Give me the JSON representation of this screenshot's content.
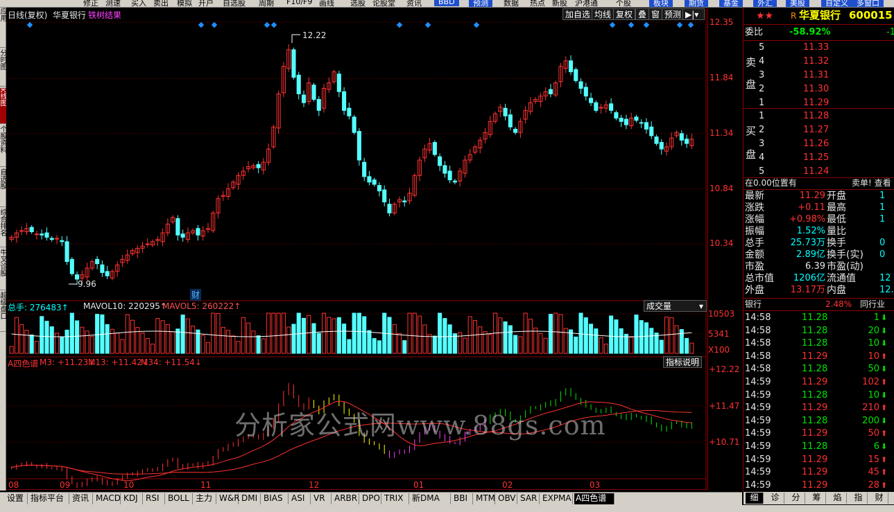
{
  "toolbar": [
    "修正",
    "测速",
    "买入",
    "卖出",
    "模拟",
    "开户",
    "自选股",
    "周期",
    "F10/F9",
    "画线",
    "选股",
    "论股堂",
    "资讯",
    "BBD",
    "预测",
    "数据",
    "热点",
    "新股",
    "沪港通",
    "个股",
    "板块",
    "期货",
    "基金",
    "外汇",
    "美股",
    "自定义",
    "多窗口"
  ],
  "left_tabs": [
    "应用",
    "分时图",
    "K线图",
    "个股资料",
    "自选股",
    "综合排名",
    "牛叉诊股",
    "超级盘口"
  ],
  "chart": {
    "period": "日线(复权)",
    "stock_name": "华夏银行",
    "pattern_label": "铁树结果",
    "buttons": [
      "加自选",
      "均线",
      "复权",
      "叠",
      "窗",
      "预测"
    ],
    "price_axis": [
      "12.35",
      "11.84",
      "11.34",
      "10.84",
      "10.34"
    ],
    "high_label": "12.22",
    "low_label": "9.96",
    "cai_label": "财",
    "volume_header": {
      "total": "总手: 276483↑",
      "mavol10": "MAVOL10: 220295↑",
      "mavol5": "MAVOL5: 260222↑"
    },
    "volume_selector": "成交量",
    "volume_axis": [
      "10503",
      "5341",
      "X100"
    ],
    "indicator_header": {
      "name": "A四色谱",
      "m3": "M3: +11.23↓",
      "m13": "M13: +11.42↓",
      "m34": "M34: +11.54↓"
    },
    "indicator_btn": "指标说明",
    "indicator_axis": [
      "+12.22",
      "+11.47",
      "+10.71"
    ],
    "months": [
      "08",
      "09",
      "10",
      "11",
      "12",
      "01",
      "02",
      "03"
    ],
    "watermark": "分析家公式网www.88gs.com"
  },
  "chart_data": {
    "type": "candlestick",
    "title": "华夏银行 600015 日线(复权)",
    "ylim": [
      9.9,
      12.4
    ],
    "high": 12.22,
    "low": 9.96,
    "x_months": [
      "08",
      "09",
      "10",
      "11",
      "12",
      "01",
      "02",
      "03"
    ],
    "close": [
      10.4,
      10.44,
      10.46,
      10.48,
      10.45,
      10.43,
      10.42,
      10.4,
      10.38,
      10.39,
      10.36,
      10.18,
      10.07,
      10.02,
      10.06,
      10.12,
      10.18,
      10.16,
      10.08,
      10.05,
      10.09,
      10.15,
      10.2,
      10.24,
      10.28,
      10.3,
      10.32,
      10.34,
      10.36,
      10.38,
      10.44,
      10.52,
      10.58,
      10.42,
      10.4,
      10.44,
      10.46,
      10.42,
      10.46,
      10.48,
      10.62,
      10.75,
      10.78,
      10.84,
      10.9,
      10.96,
      11.0,
      11.04,
      11.05,
      11.03,
      11.08,
      11.2,
      11.4,
      11.7,
      11.95,
      12.1,
      11.85,
      11.7,
      11.62,
      11.8,
      11.65,
      11.55,
      11.75,
      11.8,
      11.9,
      11.72,
      11.55,
      11.5,
      11.35,
      11.1,
      10.95,
      10.9,
      10.88,
      10.82,
      10.72,
      10.62,
      10.7,
      10.74,
      10.72,
      10.8,
      10.96,
      11.1,
      11.2,
      11.25,
      11.15,
      11.05,
      10.98,
      10.92,
      10.9,
      11.0,
      11.1,
      11.15,
      11.22,
      11.28,
      11.35,
      11.45,
      11.52,
      11.58,
      11.5,
      11.4,
      11.35,
      11.45,
      11.55,
      11.62,
      11.65,
      11.68,
      11.72,
      11.7,
      11.8,
      11.95,
      12.0,
      11.9,
      11.82,
      11.75,
      11.68,
      11.62,
      11.55,
      11.58,
      11.6,
      11.55,
      11.48,
      11.45,
      11.42,
      11.48,
      11.46,
      11.44,
      11.38,
      11.32,
      11.25,
      11.2,
      11.22,
      11.3,
      11.35,
      11.28,
      11.25,
      11.29
    ],
    "volume_max": 10503,
    "volume_mid": 5341,
    "volume_unit": "X100",
    "total_volume": 276483,
    "mavol10": 220295,
    "mavol5": 260222,
    "indicator": {
      "name": "A四色谱",
      "M3": 11.23,
      "M13": 11.42,
      "M34": 11.54,
      "axis": [
        12.22,
        11.47,
        10.71
      ]
    }
  },
  "quote": {
    "stars": "★★",
    "market_tag": "R",
    "name": "华夏银行",
    "code": "600015",
    "weibi_label": "委比",
    "weibi_value": "-58.92%",
    "weibi_extra": "-1",
    "sell_label": [
      "卖",
      "盘"
    ],
    "buy_label": [
      "买",
      "盘"
    ],
    "sells": [
      {
        "lvl": "5",
        "price": "11.33"
      },
      {
        "lvl": "4",
        "price": "11.32"
      },
      {
        "lvl": "3",
        "price": "11.31"
      },
      {
        "lvl": "2",
        "price": "11.30"
      },
      {
        "lvl": "1",
        "price": "11.29"
      }
    ],
    "buys": [
      {
        "lvl": "1",
        "price": "11.28"
      },
      {
        "lvl": "2",
        "price": "11.27"
      },
      {
        "lvl": "3",
        "price": "11.26"
      },
      {
        "lvl": "4",
        "price": "11.25"
      },
      {
        "lvl": "5",
        "price": "11.24"
      }
    ],
    "position_note": "在0.00位置有",
    "position_right": "卖单! 查看",
    "stats": [
      {
        "l1": "最新",
        "v1": "11.29",
        "c1": "red",
        "l2": "开盘",
        "v2": "1"
      },
      {
        "l1": "涨跌",
        "v1": "+0.11",
        "c1": "red",
        "l2": "最高",
        "v2": "1"
      },
      {
        "l1": "涨幅",
        "v1": "+0.98%",
        "c1": "red",
        "l2": "最低",
        "v2": "1"
      },
      {
        "l1": "振幅",
        "v1": "1.52%",
        "c1": "cyan",
        "l2": "量比",
        "v2": ""
      },
      {
        "l1": "总手",
        "v1": "25.73万",
        "c1": "cyan",
        "l2": "换手",
        "v2": "0"
      },
      {
        "l1": "金额",
        "v1": "2.89亿",
        "c1": "cyan",
        "l2": "换手(实)",
        "v2": "0"
      },
      {
        "l1": "市盈",
        "v1": "6.39",
        "c1": "white",
        "l2": "市盈(动)",
        "v2": ""
      },
      {
        "l1": "总市值",
        "v1": "1206亿",
        "c1": "cyan",
        "l2": "流通值",
        "v2": "12"
      },
      {
        "l1": "外盘",
        "v1": "13.17万",
        "c1": "red",
        "l2": "内盘",
        "v2": "12."
      }
    ],
    "bank_label": "银行",
    "bank_pct": "2.48%",
    "bank_rank": "同行业",
    "ticks": [
      {
        "t": "14:58",
        "p": "11.28",
        "v": "1",
        "d": "down"
      },
      {
        "t": "14:58",
        "p": "11.28",
        "v": "20",
        "d": "down"
      },
      {
        "t": "14:58",
        "p": "11.28",
        "v": "10",
        "d": "down"
      },
      {
        "t": "14:58",
        "p": "11.29",
        "v": "10",
        "d": "up"
      },
      {
        "t": "14:58",
        "p": "11.28",
        "v": "50",
        "d": "down"
      },
      {
        "t": "14:59",
        "p": "11.29",
        "v": "102",
        "d": "up"
      },
      {
        "t": "14:59",
        "p": "11.28",
        "v": "10",
        "d": "down"
      },
      {
        "t": "14:59",
        "p": "11.29",
        "v": "210",
        "d": "up"
      },
      {
        "t": "14:59",
        "p": "11.28",
        "v": "200",
        "d": "down"
      },
      {
        "t": "14:59",
        "p": "11.29",
        "v": "50",
        "d": "up"
      },
      {
        "t": "14:59",
        "p": "11.28",
        "v": "6",
        "d": "down"
      },
      {
        "t": "14:59",
        "p": "11.29",
        "v": "15",
        "d": "up"
      },
      {
        "t": "14:59",
        "p": "11.29",
        "v": "45",
        "d": "up"
      },
      {
        "t": "14:59",
        "p": "11.29",
        "v": "28",
        "d": "up"
      }
    ],
    "bottom_tabs": [
      "细",
      "诊",
      "分",
      "筹",
      "焰",
      "指",
      "财"
    ]
  },
  "bottom_tabs": [
    "设置",
    "指标平台",
    "资讯",
    "MACD",
    "KDJ",
    "RSI",
    "BOLL",
    "主力",
    "W&R",
    "DMI",
    "BIAS",
    "ASI",
    "VR",
    "ARBR",
    "DPO",
    "TRIX",
    "新DMA",
    "BBI",
    "MTM",
    "OBV",
    "SAR",
    "EXPMA",
    "A四色谱"
  ],
  "active_bottom_tab": "A四色谱",
  "colors": {
    "up": "#ff3232",
    "down": "#54ffff",
    "grid": "#8b0000",
    "ma": "#ffffff",
    "marker": "#1e90ff"
  }
}
